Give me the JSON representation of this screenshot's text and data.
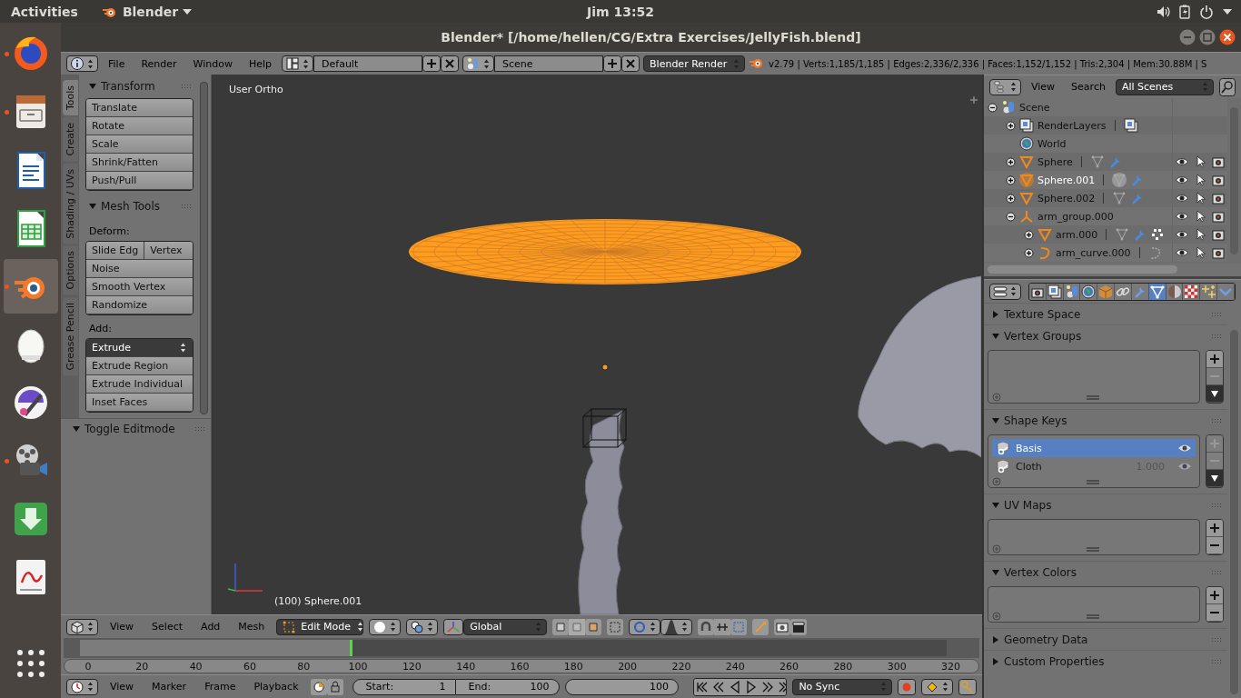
{
  "top_bar": {
    "activities": "Activities",
    "app_menu": "Blender",
    "clock": "Jim 13:52"
  },
  "dock": {
    "items": [
      {
        "kind": "browser",
        "running": true,
        "selected": false
      },
      {
        "kind": "files",
        "running": true,
        "selected": false
      },
      {
        "kind": "writer",
        "running": false,
        "selected": false
      },
      {
        "kind": "calc",
        "running": false,
        "selected": false
      },
      {
        "kind": "blender",
        "running": true,
        "selected": true
      },
      {
        "kind": "timer",
        "running": false,
        "selected": false
      },
      {
        "kind": "paint",
        "running": false,
        "selected": false
      },
      {
        "kind": "video",
        "running": true,
        "selected": false
      },
      {
        "kind": "download",
        "running": false,
        "selected": false
      },
      {
        "kind": "reader",
        "running": false,
        "selected": false
      },
      {
        "kind": "grid",
        "running": false,
        "selected": false
      }
    ]
  },
  "window": {
    "title": "Blender* [/home/hellen/CG/Extra Exercises/JellyFish.blend]"
  },
  "info_header": {
    "menus": [
      "File",
      "Render",
      "Window",
      "Help"
    ],
    "layout": "Default",
    "scene": "Scene",
    "engine": "Blender Render",
    "stats": "v2.79 | Verts:1,185/1,185 | Edges:2,336/2,336 | Faces:1,152/1,152 | Tris:2,304 | Mem:30.88M | S"
  },
  "tool_shelf": {
    "tabs": [
      {
        "label": "Tools",
        "selected": true
      },
      {
        "label": "Create",
        "selected": false
      },
      {
        "label": "Shading / UVs",
        "selected": false
      },
      {
        "label": "Options",
        "selected": false
      },
      {
        "label": "Grease Pencil",
        "selected": false
      }
    ],
    "panels": [
      {
        "title": "Transform",
        "expanded": true,
        "items": [
          {
            "kind": "button",
            "labels": [
              "Translate"
            ]
          },
          {
            "kind": "button",
            "labels": [
              "Rotate"
            ]
          },
          {
            "kind": "button",
            "labels": [
              "Scale"
            ]
          },
          {
            "kind": "button",
            "labels": [
              "Shrink/Fatten"
            ]
          },
          {
            "kind": "button",
            "labels": [
              "Push/Pull"
            ]
          }
        ]
      },
      {
        "title": "Mesh Tools",
        "expanded": true,
        "items": [
          {
            "kind": "label",
            "labels": [
              "Deform:"
            ]
          },
          {
            "kind": "button",
            "labels": [
              "Slide Edg",
              "Vertex"
            ]
          },
          {
            "kind": "button",
            "labels": [
              "Noise"
            ]
          },
          {
            "kind": "button",
            "labels": [
              "Smooth Vertex"
            ]
          },
          {
            "kind": "button",
            "labels": [
              "Randomize"
            ]
          },
          {
            "kind": "label",
            "labels": [
              "Add:"
            ]
          },
          {
            "kind": "dropdown",
            "labels": [
              "Extrude"
            ]
          },
          {
            "kind": "button",
            "labels": [
              "Extrude Region"
            ]
          },
          {
            "kind": "button",
            "labels": [
              "Extrude Individual"
            ]
          },
          {
            "kind": "button",
            "labels": [
              "Inset Faces"
            ]
          }
        ]
      }
    ],
    "operator_panel": {
      "title": "Toggle Editmode",
      "expanded": true
    }
  },
  "viewport": {
    "view_label": "User Ortho",
    "object_label": "(100) Sphere.001"
  },
  "outliner": {
    "menus": [
      "View",
      "Search"
    ],
    "filter": "All Scenes",
    "tree": [
      {
        "name": "Scene",
        "kind": "scene",
        "expanded": true,
        "selected": false,
        "children": [
          {
            "name": "RenderLayers",
            "kind": "renderlayers",
            "expanded": false,
            "selected": false,
            "extras": [
              {
                "kind": "renderlayers"
              }
            ]
          },
          {
            "name": "World",
            "kind": "world",
            "selected": false
          },
          {
            "name": "Sphere",
            "kind": "mesh",
            "expanded": false,
            "selected": false,
            "extras": [
              {
                "kind": "mesh"
              },
              {
                "kind": "modifier"
              }
            ]
          },
          {
            "name": "Sphere.001",
            "kind": "mesh",
            "expanded": false,
            "selected": true,
            "extras": [
              {
                "kind": "mesh"
              },
              {
                "kind": "modifier"
              }
            ]
          },
          {
            "name": "Sphere.002",
            "kind": "mesh",
            "expanded": false,
            "selected": false,
            "extras": [
              {
                "kind": "mesh"
              },
              {
                "kind": "modifier"
              }
            ]
          },
          {
            "name": "arm_group.000",
            "kind": "empty",
            "expanded": true,
            "selected": false,
            "children": [
              {
                "name": "arm.000",
                "kind": "mesh",
                "expanded": false,
                "selected": false,
                "extras": [
                  {
                    "kind": "mesh"
                  },
                  {
                    "kind": "modifier"
                  },
                  {
                    "kind": "vertices"
                  }
                ]
              },
              {
                "name": "arm_curve.000",
                "kind": "curve",
                "expanded": false,
                "selected": false,
                "extras": [
                  {
                    "kind": "curve"
                  }
                ]
              }
            ]
          }
        ]
      }
    ]
  },
  "properties": {
    "tabs": [
      {
        "kind": "render",
        "selected": false
      },
      {
        "kind": "layers",
        "selected": false
      },
      {
        "kind": "scene",
        "selected": false
      },
      {
        "kind": "world",
        "selected": false
      },
      {
        "kind": "object",
        "selected": false
      },
      {
        "kind": "constraints",
        "selected": false
      },
      {
        "kind": "modifiers",
        "selected": false
      },
      {
        "kind": "data",
        "selected": true
      },
      {
        "kind": "material",
        "selected": false
      },
      {
        "kind": "texture",
        "selected": false
      },
      {
        "kind": "particles",
        "selected": false
      },
      {
        "kind": "physics",
        "selected": false
      }
    ],
    "panels": [
      {
        "title": "Texture Space",
        "expanded": false
      },
      {
        "title": "Vertex Groups",
        "expanded": true,
        "add_enabled": true,
        "remove_enabled": false,
        "specials": true
      },
      {
        "title": "Shape Keys",
        "expanded": true,
        "add_enabled": false,
        "remove_enabled": false,
        "specials": true,
        "rows": [
          {
            "name": "Basis",
            "selected": true
          },
          {
            "name": "Cloth",
            "value": "1.000",
            "selected": false
          }
        ]
      },
      {
        "title": "UV Maps",
        "expanded": true,
        "add_enabled": true,
        "remove_enabled": true,
        "specials": false
      },
      {
        "title": "Vertex Colors",
        "expanded": true,
        "add_enabled": true,
        "remove_enabled": true,
        "specials": false
      },
      {
        "title": "Geometry Data",
        "expanded": false
      },
      {
        "title": "Custom Properties",
        "expanded": false
      }
    ]
  },
  "view3d_header": {
    "menus": [
      "View",
      "Select",
      "Add",
      "Mesh"
    ],
    "mode": "Edit Mode",
    "orientation": "Global"
  },
  "timeline": {
    "ticks": [
      "0",
      "20",
      "40",
      "60",
      "80",
      "100",
      "120",
      "140",
      "160",
      "180",
      "200",
      "220",
      "240",
      "260",
      "280",
      "300",
      "320"
    ],
    "playhead": {
      "level": 0.3125
    }
  },
  "timeline_header": {
    "menus": [
      "View",
      "Marker",
      "Frame",
      "Playback"
    ],
    "start_label": "Start:",
    "start": "1",
    "end_label": "End:",
    "end": "100",
    "current": "100",
    "sync": "No Sync"
  }
}
